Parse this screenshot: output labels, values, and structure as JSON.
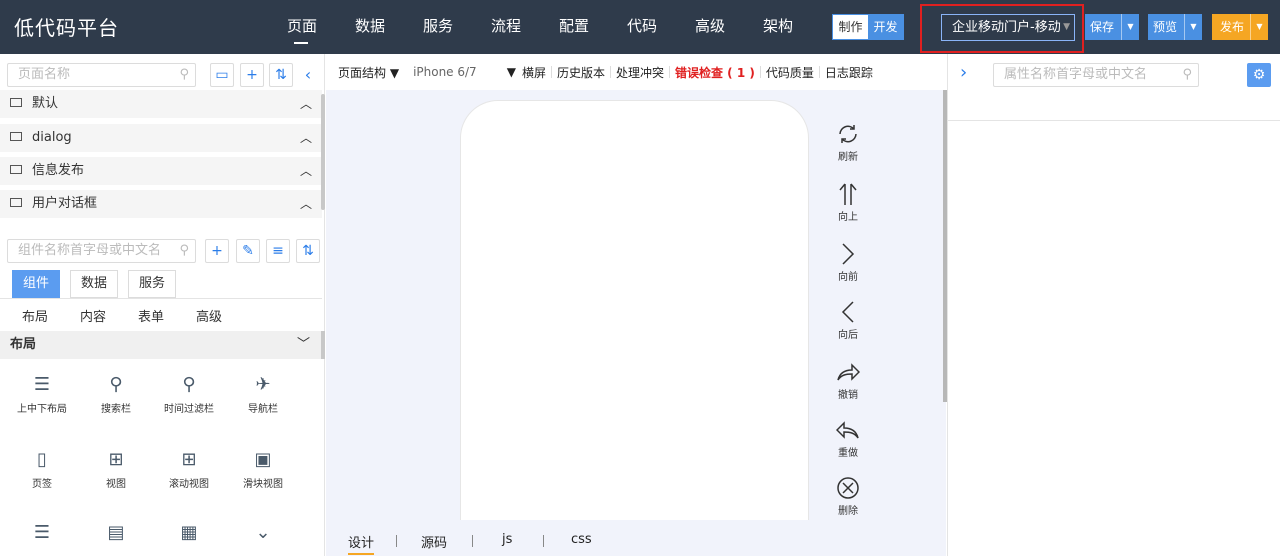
{
  "app": {
    "title": "低代码平台"
  },
  "nav": [
    "页面",
    "数据",
    "服务",
    "流程",
    "配置",
    "代码",
    "高级",
    "架构"
  ],
  "mode": {
    "make": "制作",
    "dev": "开发"
  },
  "project_select": {
    "value": "企业移动门户-移动"
  },
  "actions": {
    "save": "保存",
    "preview": "预览",
    "publish": "发布"
  },
  "left": {
    "page_search_placeholder": "页面名称",
    "tree": [
      "默认",
      "dialog",
      "信息发布",
      "用户对话框"
    ],
    "comp_search_placeholder": "组件名称首字母或中文名",
    "tabs": [
      "组件",
      "数据",
      "服务"
    ],
    "subtabs": [
      "布局",
      "内容",
      "表单",
      "高级"
    ],
    "section": "布局",
    "components": [
      "上中下布局",
      "搜索栏",
      "时间过滤栏",
      "导航栏",
      "页签",
      "视图",
      "滚动视图",
      "滑块视图"
    ]
  },
  "toolbar": {
    "structure": "页面结构",
    "device": "iPhone 6/7",
    "landscape": "横屏",
    "history": "历史版本",
    "conflict": "处理冲突",
    "error_check": "错误检查 ( 1 )",
    "quality": "代码质量",
    "log": "日志跟踪"
  },
  "tools": [
    "刷新",
    "向上",
    "向前",
    "向后",
    "撤销",
    "重做",
    "删除"
  ],
  "bottom_tabs": [
    "设计",
    "源码",
    "js",
    "css"
  ],
  "right": {
    "search_placeholder": "属性名称首字母或中文名"
  },
  "colors": {
    "topbar": "#2f3b4b",
    "accent": "#4a90e2",
    "publish": "#f5a623",
    "error": "#e02020"
  }
}
